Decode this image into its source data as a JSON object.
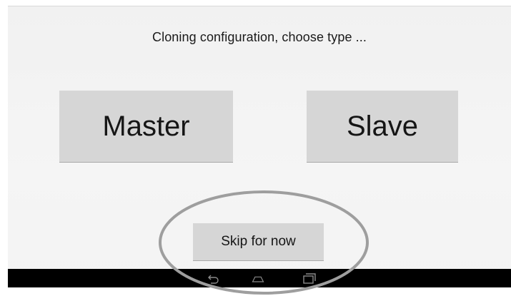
{
  "dialog": {
    "prompt": "Cloning configuration, choose type ...",
    "master_label": "Master",
    "slave_label": "Slave",
    "skip_label": "Skip for now"
  },
  "navbar": {
    "icons": [
      "back-icon",
      "home-icon",
      "recent-apps-icon"
    ]
  },
  "annotation": {
    "shape": "ellipse",
    "color": "#a0a0a0",
    "highlights": "skip-button"
  },
  "colors": {
    "background": "#f3f3f3",
    "button": "#d6d6d6",
    "navbar": "#000000"
  }
}
